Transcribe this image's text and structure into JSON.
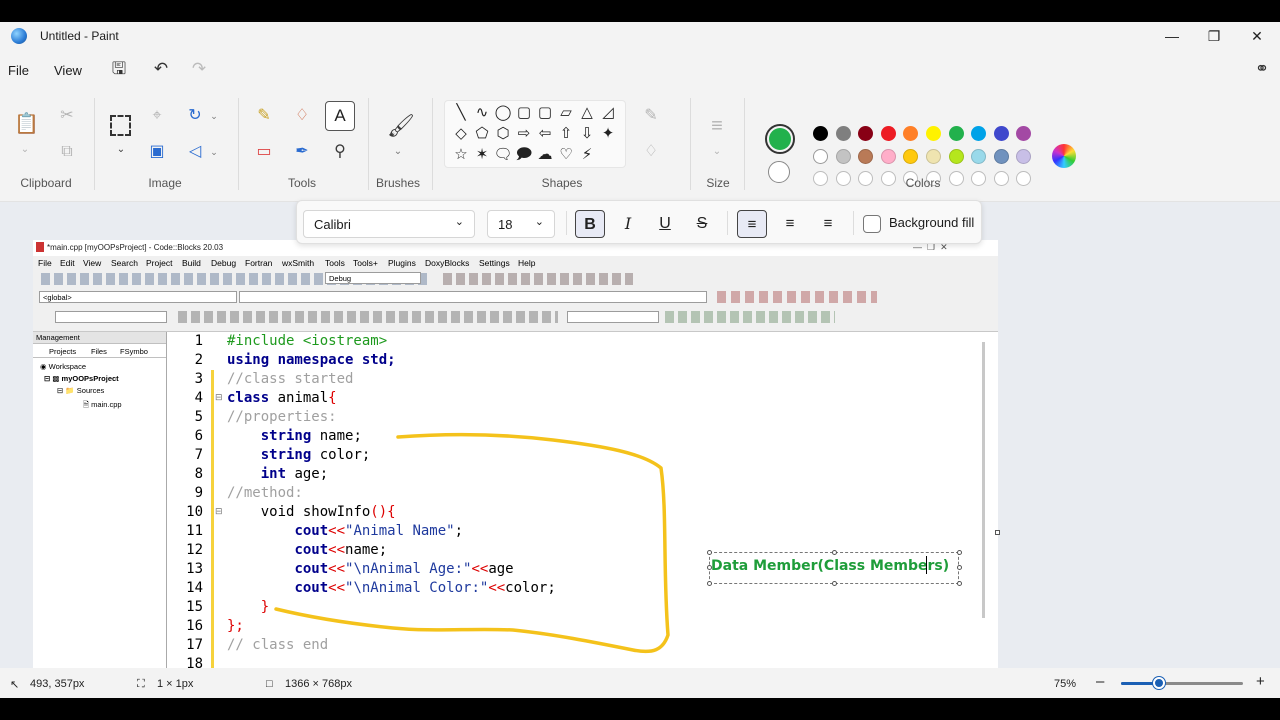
{
  "window": {
    "title": "Untitled - Paint"
  },
  "menu": {
    "file": "File",
    "view": "View"
  },
  "ribbon": {
    "groups": {
      "clipboard": "Clipboard",
      "image": "Image",
      "tools": "Tools",
      "brushes": "Brushes",
      "shapes": "Shapes",
      "size": "Size",
      "colors": "Colors"
    },
    "palette_row1": [
      "#000000",
      "#7f7f7f",
      "#880015",
      "#ed1c24",
      "#ff7f27",
      "#fff200",
      "#22b14c",
      "#00a2e8",
      "#3f48cc",
      "#a349a4"
    ],
    "palette_row2": [
      "#ffffff",
      "#c3c3c3",
      "#b97a57",
      "#ffaec9",
      "#ffc90e",
      "#efe4b0",
      "#b5e61d",
      "#99d9ea",
      "#7092be",
      "#c8bfe7"
    ],
    "color1": "#22b14c",
    "color2": "#ffffff"
  },
  "textbar": {
    "font": "Calibri",
    "size": "18",
    "bold": "B",
    "italic": "I",
    "underline": "U",
    "strike": "S",
    "background_fill": "Background fill"
  },
  "codeblocks": {
    "title": "*main.cpp [myOOPsProject] - Code::Blocks 20.03",
    "menu": [
      "File",
      "Edit",
      "View",
      "Search",
      "Project",
      "Build",
      "Debug",
      "Fortran",
      "wxSmith",
      "Tools",
      "Tools+",
      "Plugins",
      "DoxyBlocks",
      "Settings",
      "Help"
    ],
    "build_target": "Debug",
    "scope": "<global>",
    "management": "Management",
    "tabs": [
      "Projects",
      "Files",
      "FSymbo"
    ],
    "tree": [
      "Workspace",
      "myOOPsProject",
      "Sources",
      "main.cpp"
    ],
    "line_numbers": [
      "1",
      "2",
      "3",
      "4",
      "5",
      "6",
      "7",
      "8",
      "9",
      "10",
      "11",
      "12",
      "13",
      "14",
      "15",
      "16",
      "17",
      "18"
    ],
    "code": {
      "l1": "#include <iostream>",
      "l2a": "using namespace",
      "l2b": " std;",
      "l3": "//class started",
      "l4a": "class",
      "l4b": " animal",
      "l4c": "{",
      "l5": "//properties:",
      "l6a": "string",
      "l6b": " name;",
      "l7a": "string",
      "l7b": " color;",
      "l8a": "int",
      "l8b": " age;",
      "l9": "//method:",
      "l10a": "void",
      "l10b": " showInfo",
      "l10c": "(){",
      "l11a": "cout",
      "l11b": "<<",
      "l11c": "\"Animal Name\"",
      "l11d": ";",
      "l12a": "cout",
      "l12b": "<<",
      "l12c": "name;",
      "l13a": "cout",
      "l13b": "<<",
      "l13c": "\"\\nAnimal Age:\"",
      "l13d": "<<",
      "l13e": "age",
      "l14a": "cout",
      "l14b": "<<",
      "l14c": "\"\\nAnimal Color:\"",
      "l14d": "<<",
      "l14e": "color;",
      "l15": "}",
      "l16": "};",
      "l17": "// class end"
    }
  },
  "annotation": {
    "text": "Data Member(Class Members)",
    "color": "#1f9d3a",
    "stroke": "#f4c21b"
  },
  "status": {
    "cursor": "493, 357px",
    "selection": "1 × 1px",
    "canvas_size": "1366 × 768px",
    "zoom": "75%"
  }
}
